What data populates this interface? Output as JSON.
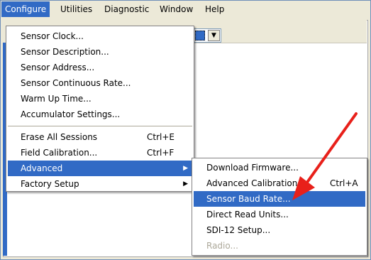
{
  "menubar": {
    "items": [
      "Configure",
      "Utilities",
      "Diagnostic",
      "Window",
      "Help"
    ]
  },
  "toolbar": {
    "combo_arrow": "▼"
  },
  "configure_menu": {
    "items": [
      {
        "label": "Sensor Clock...",
        "shortcut": ""
      },
      {
        "label": "Sensor Description...",
        "shortcut": ""
      },
      {
        "label": "Sensor Address...",
        "shortcut": ""
      },
      {
        "label": "Sensor Continuous Rate...",
        "shortcut": ""
      },
      {
        "label": "Warm Up Time...",
        "shortcut": ""
      },
      {
        "label": "Accumulator Settings...",
        "shortcut": ""
      },
      {
        "label": "Erase All Sessions",
        "shortcut": "Ctrl+E"
      },
      {
        "label": "Field Calibration...",
        "shortcut": "Ctrl+F"
      },
      {
        "label": "Advanced",
        "shortcut": "",
        "submenu": true
      },
      {
        "label": "Factory Setup",
        "shortcut": "",
        "submenu": true
      }
    ],
    "submenu_glyph": "▶"
  },
  "advanced_menu": {
    "items": [
      {
        "label": "Download Firmware...",
        "shortcut": ""
      },
      {
        "label": "Advanced Calibration...",
        "shortcut": "Ctrl+A"
      },
      {
        "label": "Sensor Baud Rate...",
        "shortcut": ""
      },
      {
        "label": "Direct Read Units...",
        "shortcut": ""
      },
      {
        "label": "SDI-12 Setup...",
        "shortcut": ""
      },
      {
        "label": "Radio...",
        "shortcut": "",
        "disabled": true
      }
    ]
  },
  "colors": {
    "highlight": "#316ac5",
    "arrow": "#e8201a"
  }
}
